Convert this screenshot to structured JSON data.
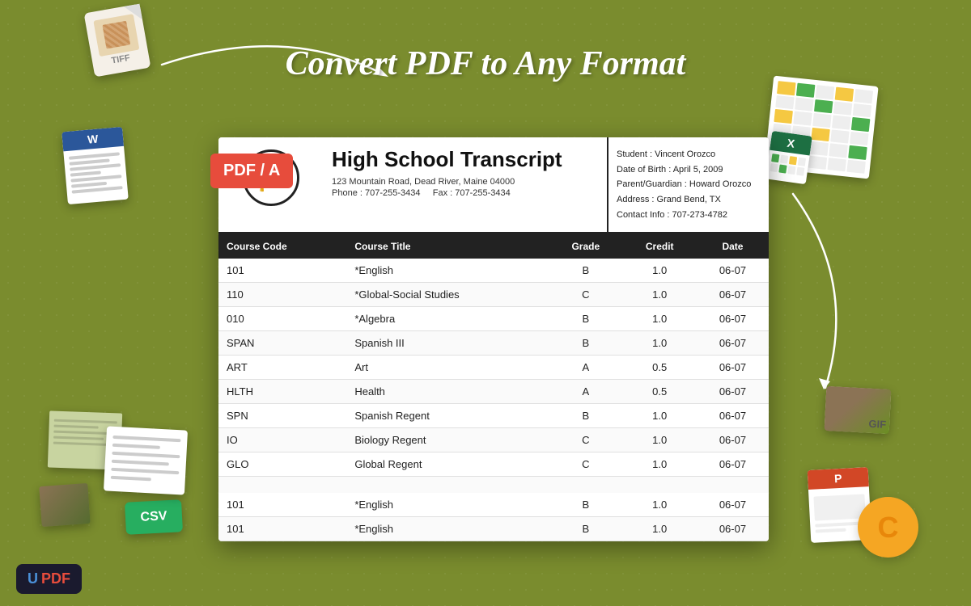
{
  "page": {
    "title": "Convert PDF to Any Format",
    "background_color": "#7a8c2e"
  },
  "brand": {
    "name": "UPDF",
    "u_part": "U",
    "pdf_part": "PDF"
  },
  "pdf_badge": {
    "label": "PDF / A"
  },
  "document": {
    "title": "High School Transcript",
    "address": "123 Mountain Road, Dead River, Maine 04000",
    "phone": "Phone : 707-255-3434",
    "fax": "Fax : 707-255-3434",
    "student_label": "Student :",
    "student_name": "Vincent Orozco",
    "dob_label": "Date of Birth :",
    "dob_value": "April 5,  2009",
    "guardian_label": "Parent/Guardian :",
    "guardian_name": "Howard Orozco",
    "address_label": "Address :",
    "address_value": "Grand Bend, TX",
    "contact_label": "Contact Info :",
    "contact_value": "707-273-4782"
  },
  "table": {
    "headers": [
      "Course Code",
      "Course Title",
      "Grade",
      "Credit",
      "Date"
    ],
    "rows": [
      {
        "code": "101",
        "title": "*English",
        "grade": "B",
        "credit": "1.0",
        "date": "06-07"
      },
      {
        "code": "110",
        "title": "*Global-Social Studies",
        "grade": "C",
        "credit": "1.0",
        "date": "06-07"
      },
      {
        "code": "010",
        "title": "*Algebra",
        "grade": "B",
        "credit": "1.0",
        "date": "06-07"
      },
      {
        "code": "SPAN",
        "title": "Spanish III",
        "grade": "B",
        "credit": "1.0",
        "date": "06-07"
      },
      {
        "code": "ART",
        "title": "Art",
        "grade": "A",
        "credit": "0.5",
        "date": "06-07"
      },
      {
        "code": "HLTH",
        "title": "Health",
        "grade": "A",
        "credit": "0.5",
        "date": "06-07"
      },
      {
        "code": "SPN",
        "title": "Spanish Regent",
        "grade": "B",
        "credit": "1.0",
        "date": "06-07"
      },
      {
        "code": "IO",
        "title": "Biology Regent",
        "grade": "C",
        "credit": "1.0",
        "date": "06-07"
      },
      {
        "code": "GLO",
        "title": "Global Regent",
        "grade": "C",
        "credit": "1.0",
        "date": "06-07"
      }
    ],
    "extra_rows": [
      {
        "code": "101",
        "title": "*English",
        "grade": "B",
        "credit": "1.0",
        "date": "06-07"
      },
      {
        "code": "101",
        "title": "*English",
        "grade": "B",
        "credit": "1.0",
        "date": "06-07"
      }
    ]
  },
  "decorative": {
    "tiff_label": "TIFF",
    "csv_label": "CSV",
    "gif_label": "GIF",
    "word_label": "W",
    "excel_label": "X",
    "ppt_label": "P",
    "c_label": "C"
  }
}
